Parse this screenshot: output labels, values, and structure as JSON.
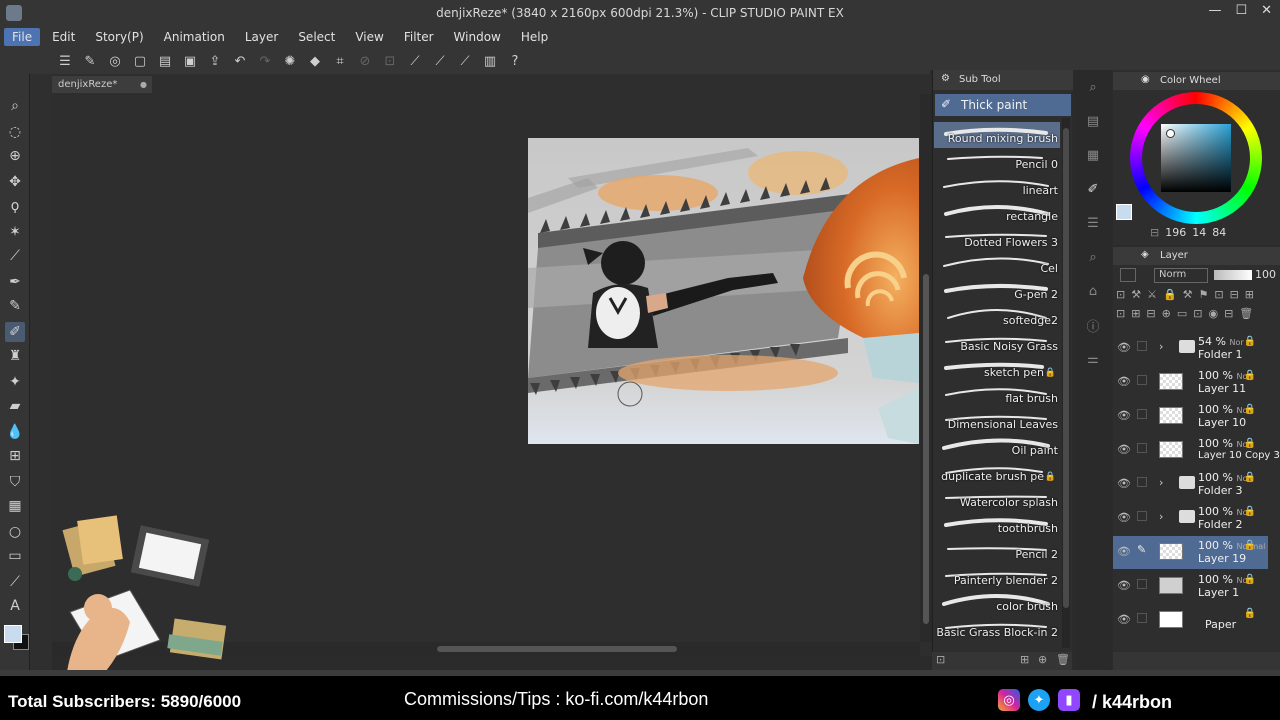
{
  "window": {
    "title": "denjixReze* (3840 x 2160px 600dpi 21.3%) - CLIP STUDIO PAINT EX",
    "controls": [
      "—",
      "☐",
      "✕"
    ]
  },
  "menu": [
    "File",
    "Edit",
    "Story(P)",
    "Animation",
    "Layer",
    "Select",
    "View",
    "Filter",
    "Window",
    "Help"
  ],
  "document": {
    "tab": "denjixReze*"
  },
  "subtool": {
    "header": "Sub Tool",
    "group": "Thick paint",
    "brushes": [
      {
        "name": "Round mixing brush",
        "selected": true,
        "locked": false
      },
      {
        "name": "Pencil 0",
        "selected": false,
        "locked": false
      },
      {
        "name": "lineart",
        "selected": false,
        "locked": false
      },
      {
        "name": "rectangle",
        "selected": false,
        "locked": false
      },
      {
        "name": "Dotted Flowers 3",
        "selected": false,
        "locked": false
      },
      {
        "name": "Cel",
        "selected": false,
        "locked": false
      },
      {
        "name": "G-pen 2",
        "selected": false,
        "locked": false
      },
      {
        "name": "softedge2",
        "selected": false,
        "locked": false
      },
      {
        "name": "Basic Noisy Grass",
        "selected": false,
        "locked": false
      },
      {
        "name": "sketch pen",
        "selected": false,
        "locked": true
      },
      {
        "name": "flat brush",
        "selected": false,
        "locked": false
      },
      {
        "name": "Dimensional Leaves",
        "selected": false,
        "locked": false
      },
      {
        "name": "Oil paint",
        "selected": false,
        "locked": false
      },
      {
        "name": "duplicate brush pe",
        "selected": false,
        "locked": true
      },
      {
        "name": "Watercolor splash",
        "selected": false,
        "locked": false
      },
      {
        "name": "toothbrush",
        "selected": false,
        "locked": false
      },
      {
        "name": "Pencil 2",
        "selected": false,
        "locked": false
      },
      {
        "name": "Painterly blender 2",
        "selected": false,
        "locked": false
      },
      {
        "name": "color brush",
        "selected": false,
        "locked": false
      },
      {
        "name": "Basic Grass Block-in 2",
        "selected": false,
        "locked": false
      }
    ]
  },
  "color": {
    "header": "Color Wheel",
    "values": [
      "196",
      "14",
      "84"
    ],
    "selected_color": "#c9dcee",
    "accent": "#4f6a93"
  },
  "layers": {
    "header": "Layer",
    "blend_mode": "Norm",
    "opacity": "100",
    "items": [
      {
        "pct": "54 %",
        "blend": "Nor",
        "name": "Folder 1",
        "type": "folder",
        "selected": false
      },
      {
        "pct": "100 %",
        "blend": "Nor",
        "name": "Layer 11",
        "type": "layer",
        "selected": false
      },
      {
        "pct": "100 %",
        "blend": "Nor",
        "name": "Layer 10",
        "type": "layer",
        "selected": false
      },
      {
        "pct": "100 %",
        "blend": "Nor",
        "name": "Layer 10 Copy 3",
        "type": "layer",
        "selected": false
      },
      {
        "pct": "100 %",
        "blend": "Nc",
        "name": "Folder 3",
        "type": "folder",
        "selected": false
      },
      {
        "pct": "100 %",
        "blend": "Nc",
        "name": "Folder 2",
        "type": "folder",
        "selected": false
      },
      {
        "pct": "100 %",
        "blend": "Normal",
        "name": "Layer 19",
        "type": "layer",
        "selected": true
      },
      {
        "pct": "100 %",
        "blend": "Nor",
        "name": "Layer 1",
        "type": "layer",
        "selected": false
      },
      {
        "pct": "",
        "blend": "",
        "name": "Paper",
        "type": "paper",
        "selected": false
      }
    ]
  },
  "overlay": {
    "subscribers": "Total Subscribers: 5890/6000",
    "commissions": "Commissions/Tips : ko-fi.com/k44rbon",
    "handle": "/ k44rbon"
  }
}
